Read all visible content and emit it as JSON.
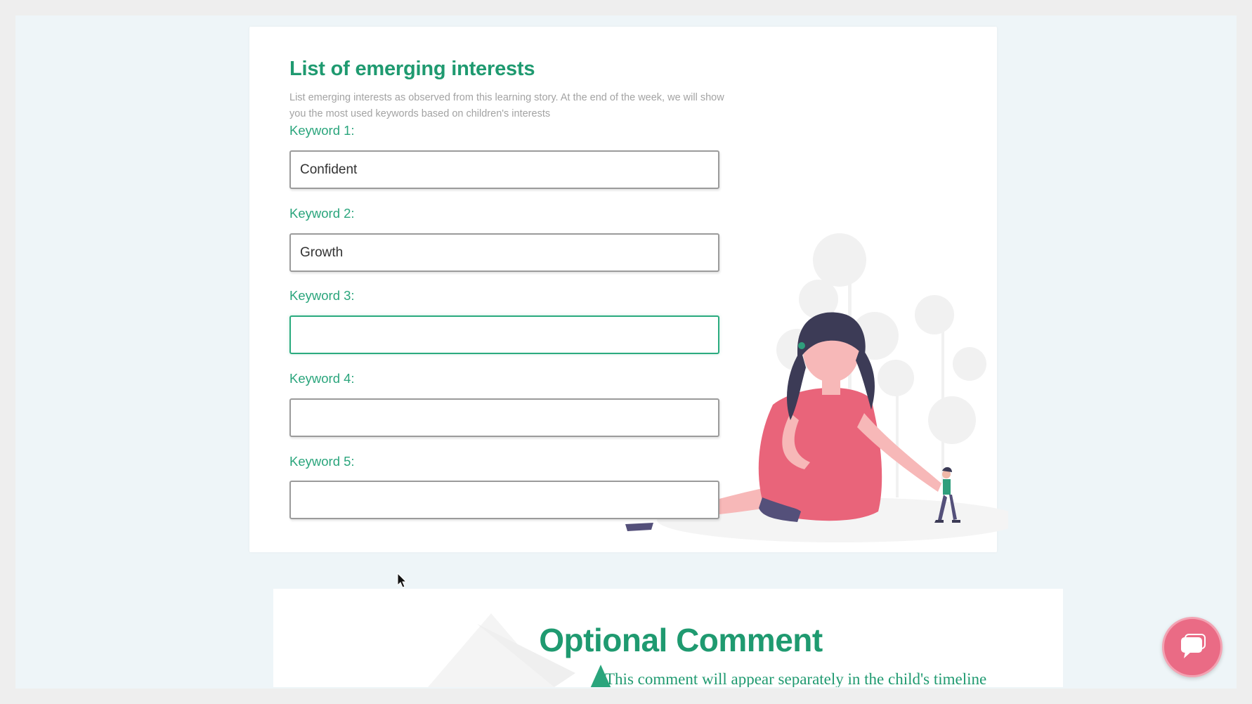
{
  "interests": {
    "title": "List of emerging interests",
    "description": "List emerging interests as observed from this learning story. At the end of the week, we will show you the most used keywords based on children's interests",
    "keywords": [
      {
        "label": "Keyword 1:",
        "value": "Confident"
      },
      {
        "label": "Keyword 2:",
        "value": "Growth"
      },
      {
        "label": "Keyword 3:",
        "value": ""
      },
      {
        "label": "Keyword 4:",
        "value": ""
      },
      {
        "label": "Keyword 5:",
        "value": ""
      }
    ]
  },
  "comment": {
    "title": "Optional Comment",
    "subtitle": "This comment will appear separately in the child's timeline"
  },
  "chat": {
    "icon": "chat-bubble-icon"
  },
  "colors": {
    "accent": "#1f9a70",
    "fab": "#ea6b85",
    "dress": "#e9647a"
  }
}
